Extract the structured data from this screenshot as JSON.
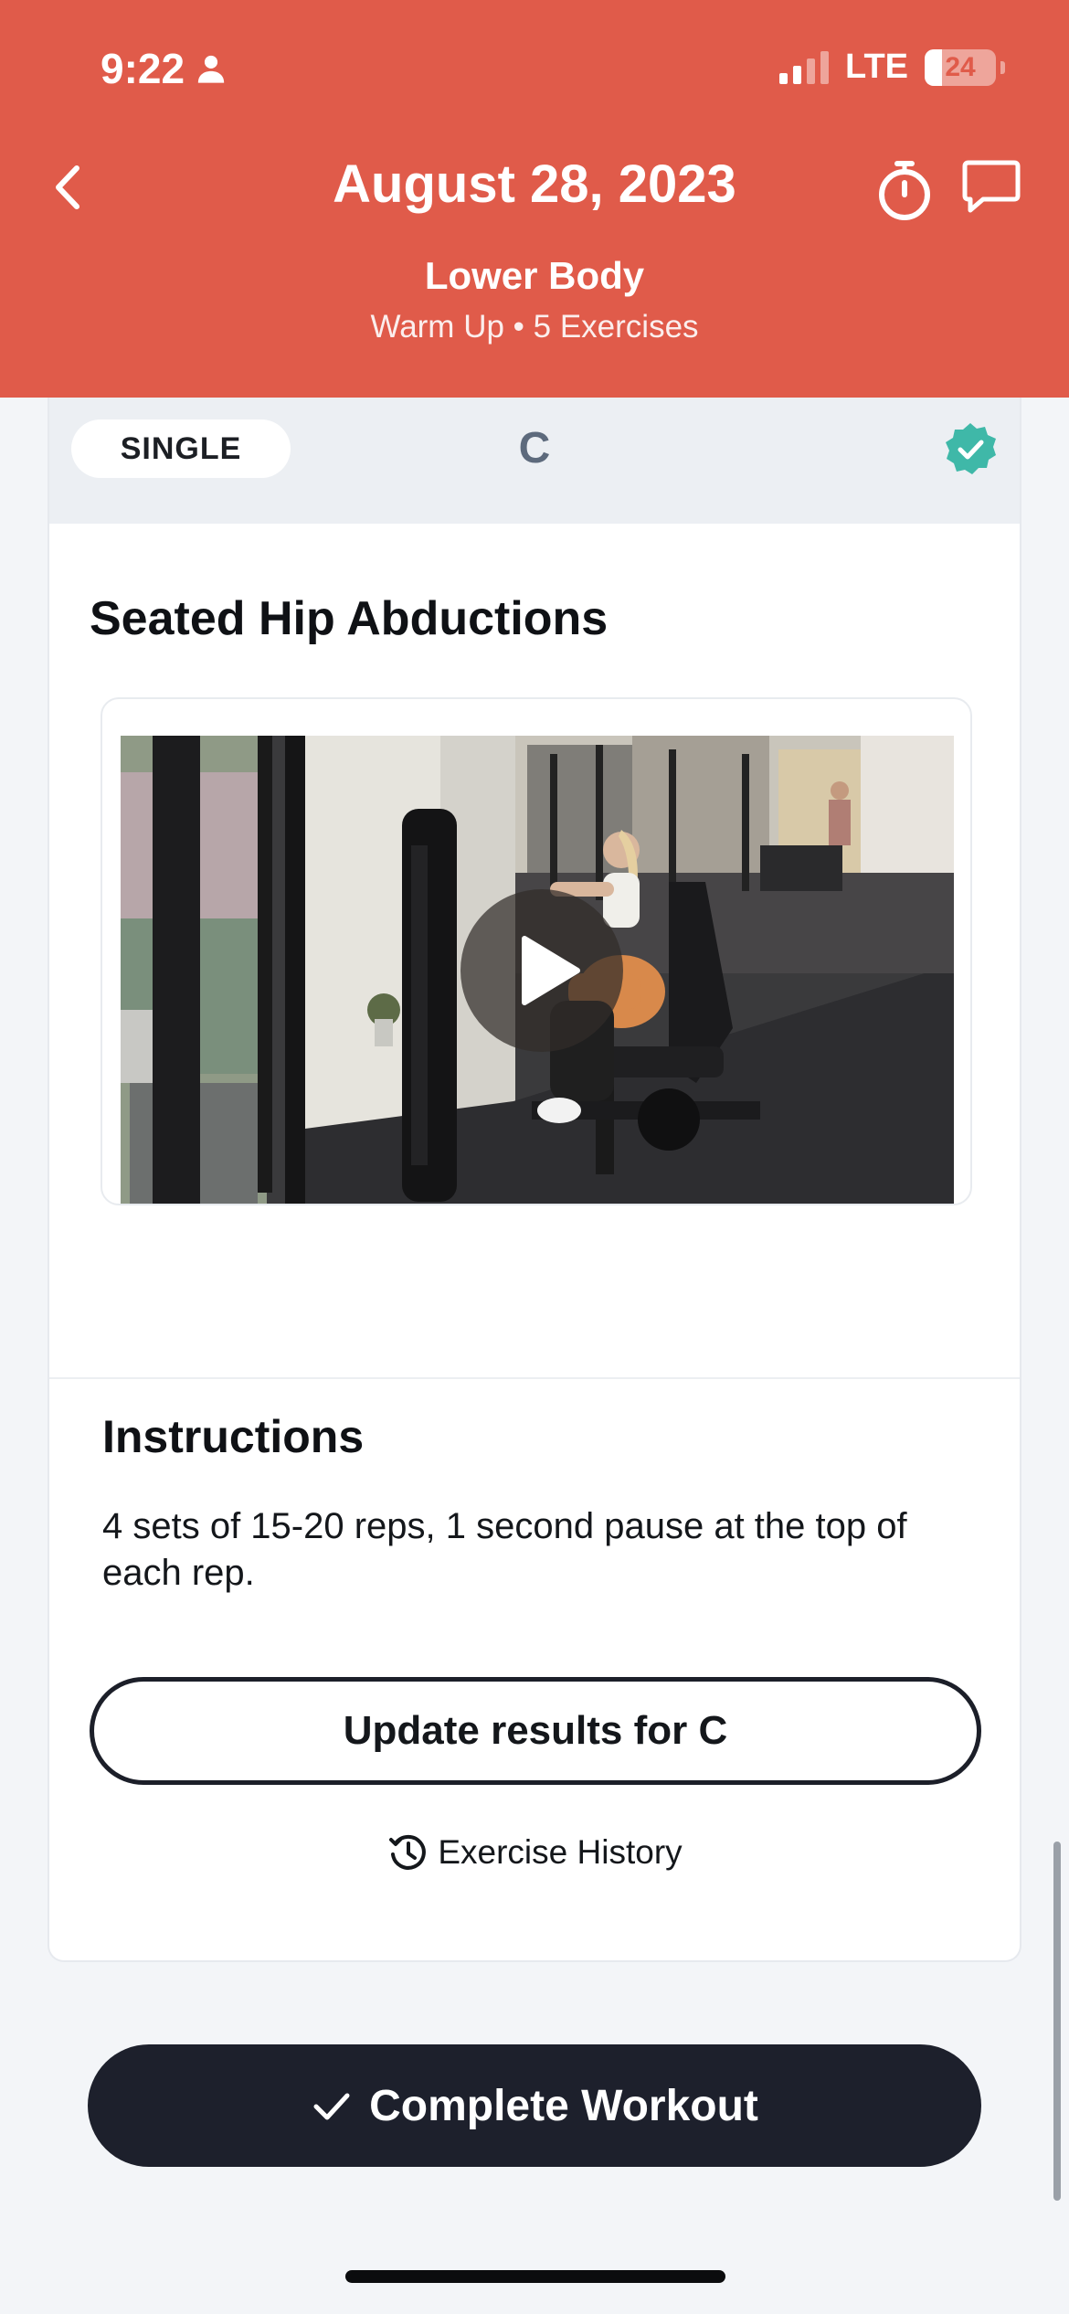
{
  "status_bar": {
    "time": "9:22",
    "network": "LTE",
    "battery": "24",
    "battery_level": 0.24,
    "signal_bars": 2
  },
  "header": {
    "date": "August 28, 2023",
    "workout_name": "Lower Body",
    "subtitle": "Warm Up • 5 Exercises",
    "background_color": "#e05b4a"
  },
  "exercise_card": {
    "type_label": "SINGLE",
    "group_letter": "C",
    "completed": true,
    "check_color": "#3fb8a8",
    "title": "Seated Hip Abductions",
    "instructions_heading": "Instructions",
    "instructions_text": "4 sets of 15-20 reps, 1 second pause at the top of each rep.",
    "update_button_label": "Update results for C",
    "history_link_label": "Exercise History"
  },
  "footer": {
    "complete_button_label": "Complete Workout",
    "button_color": "#1d202c"
  }
}
